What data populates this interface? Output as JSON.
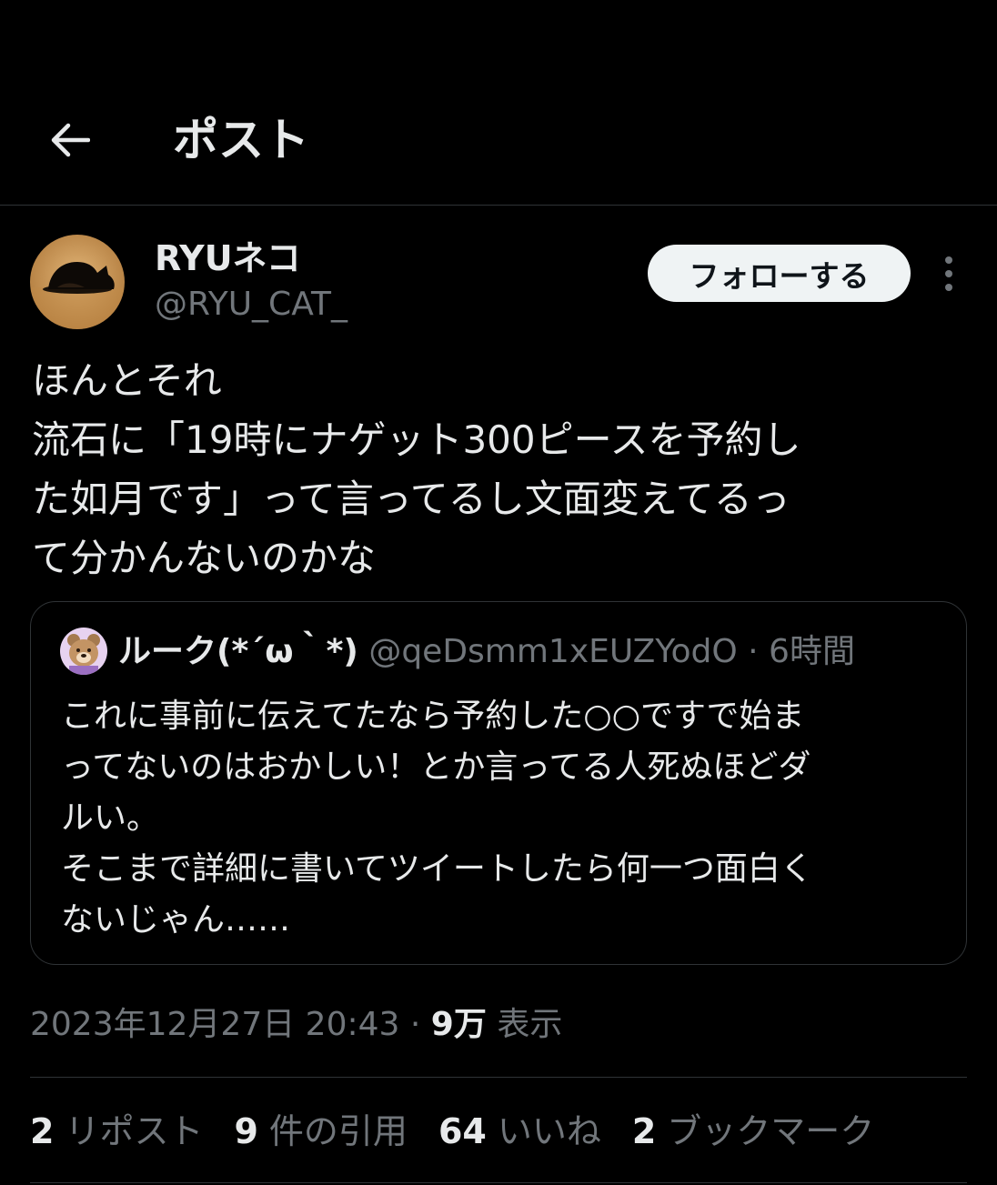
{
  "header": {
    "back_icon": "arrow-left-icon",
    "title": "ポスト"
  },
  "author": {
    "name": "RYUネコ",
    "handle": "@RYU_CAT_",
    "follow_label": "フォローする",
    "more_icon": "more-vertical-icon"
  },
  "post": {
    "lines": [
      "ほんとそれ",
      "流石に「19時にナゲット300ピースを予約し",
      "た如月です」って言ってるし文面変えてるっ",
      "て分かんないのかな"
    ]
  },
  "quote": {
    "name": "ルーク(*´ω｀*)",
    "handle": "@qeDsmm1xEUZYodO",
    "separator": "·",
    "time": "6時間",
    "lines": [
      "これに事前に伝えてたなら予約した○○ですで始ま",
      "ってないのはおかしい！とか言ってる人死ぬほどダ",
      "ルい。",
      "そこまで詳細に書いてツイートしたら何一つ面白く",
      "ないじゃん……"
    ]
  },
  "meta": {
    "datetime": "2023年12月27日 20:43",
    "separator": "·",
    "views_count": "9万",
    "views_label": "表示"
  },
  "stats": {
    "reposts_count": "2",
    "reposts_label": "リポスト",
    "quotes_count": "9",
    "quotes_label": "件の引用",
    "likes_count": "64",
    "likes_label": "いいね",
    "bookmarks_count": "2",
    "bookmarks_label": "ブックマーク"
  },
  "colors": {
    "background": "#000000",
    "text_primary": "#e7e9ea",
    "text_secondary": "#71767b",
    "border": "#2f3336",
    "follow_button_bg": "#eff3f4"
  }
}
